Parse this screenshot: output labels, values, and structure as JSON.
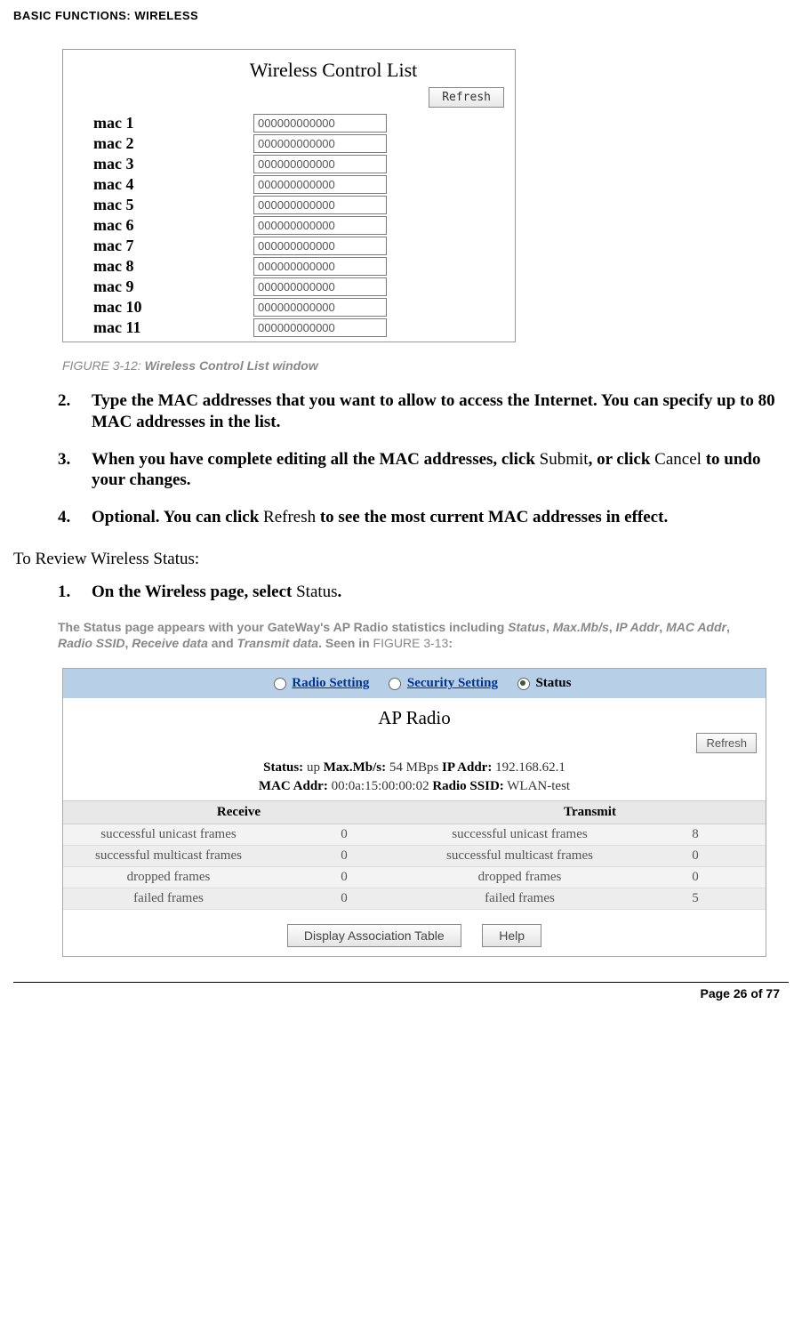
{
  "header": "BASIC FUNCTIONS: WIRELESS",
  "fig1": {
    "title": "Wireless Control List",
    "refresh": "Refresh",
    "rows": [
      {
        "label": "mac 1",
        "value": "000000000000"
      },
      {
        "label": "mac 2",
        "value": "000000000000"
      },
      {
        "label": "mac 3",
        "value": "000000000000"
      },
      {
        "label": "mac 4",
        "value": "000000000000"
      },
      {
        "label": "mac 5",
        "value": "000000000000"
      },
      {
        "label": "mac 6",
        "value": "000000000000"
      },
      {
        "label": "mac 7",
        "value": "000000000000"
      },
      {
        "label": "mac 8",
        "value": "000000000000"
      },
      {
        "label": "mac 9",
        "value": "000000000000"
      },
      {
        "label": "mac 10",
        "value": "000000000000"
      },
      {
        "label": "mac 11",
        "value": "000000000000"
      }
    ],
    "caption_prefix": "FIGURE 3-12: ",
    "caption_bold": "Wireless Control List window"
  },
  "steps_a": [
    {
      "n": "2.",
      "b1": "Type the MAC addresses that you want to allow to access the Internet. You can specify up to 80 MAC addresses in the list."
    },
    {
      "n": "3.",
      "b1": "When you have complete editing all the MAC addresses, click ",
      "p1": "Submit",
      "b2": ", or click ",
      "p2": "Cancel",
      "b3": " to undo your changes."
    },
    {
      "n": "4.",
      "b1": "Optional. You can click ",
      "p1": "Refresh",
      "b2": " to see the most current MAC addresses in effect."
    }
  ],
  "sectionB": "To Review Wireless Status:",
  "steps_b": [
    {
      "n": "1.",
      "b1": "On the Wireless page, select ",
      "p1": "Status",
      "b2": "."
    }
  ],
  "gray_note": {
    "t1": "The Status page appears with your GateWay's AP Radio statistics including ",
    "i1": "Status",
    "c": ", ",
    "i2": "Max.Mb/s",
    "i3": "IP Addr",
    "i4": "MAC Addr",
    "i5": "Radio SSID",
    "i6": "Receive data",
    "and": " and ",
    "i7": "Transmit data",
    "t2": ". Seen in ",
    "fig": "FIGURE 3-13",
    "t3": ":"
  },
  "fig2": {
    "tabs": {
      "radio": "Radio Setting",
      "security": "Security Setting",
      "status": "Status"
    },
    "ap_title": "AP Radio",
    "refresh": "Refresh",
    "status_label": "Status:",
    "status_val": " up  ",
    "max_label": "Max.Mb/s:",
    "max_val": " 54 MBps  ",
    "ip_label": "IP Addr:",
    "ip_val": " 192.168.62.1",
    "mac_label": "MAC Addr:",
    "mac_val": " 00:0a:15:00:00:02  ",
    "ssid_label": "Radio SSID:",
    "ssid_val": " WLAN-test",
    "col_recv": "Receive",
    "col_xmit": "Transmit",
    "rows": [
      {
        "rl": "successful unicast frames",
        "rv": "0",
        "tl": "successful unicast frames",
        "tv": "8"
      },
      {
        "rl": "successful multicast frames",
        "rv": "0",
        "tl": "successful multicast frames",
        "tv": "0"
      },
      {
        "rl": "dropped frames",
        "rv": "0",
        "tl": "dropped frames",
        "tv": "0"
      },
      {
        "rl": "failed frames",
        "rv": "0",
        "tl": "failed frames",
        "tv": "5"
      }
    ],
    "btn1": "Display Association Table",
    "btn2": "Help"
  },
  "footer": "Page 26 of 77"
}
